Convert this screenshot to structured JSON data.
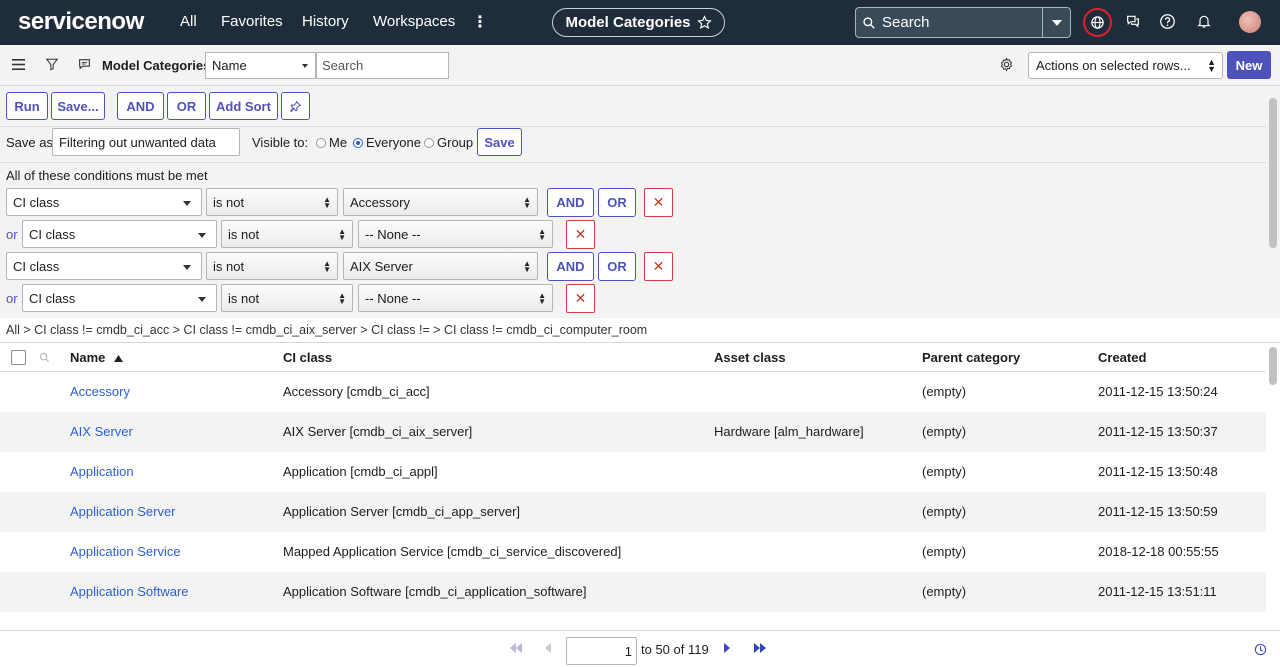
{
  "nav": {
    "logo": "servicenow",
    "links": [
      "All",
      "Favorites",
      "History",
      "Workspaces"
    ],
    "center_pill": "Model Categories",
    "search_placeholder": "Search"
  },
  "listbar": {
    "title": "Model Categories",
    "field_select": "Name",
    "search_placeholder": "Search",
    "actions_select": "Actions on selected rows...",
    "new_label": "New"
  },
  "filter": {
    "buttons": {
      "run": "Run",
      "save_dots": "Save...",
      "and": "AND",
      "or": "OR",
      "add_sort": "Add Sort"
    },
    "save_as_label": "Save as:",
    "save_as_value": "Filtering out unwanted data",
    "visible_to_label": "Visible to:",
    "visible_options": [
      "Me",
      "Everyone",
      "Group"
    ],
    "visible_selected": "Everyone",
    "save_label": "Save",
    "conditions_heading": "All of these conditions must be met",
    "or_label": "or",
    "conditions": [
      {
        "field": "CI class",
        "operator": "is not",
        "value": "Accessory",
        "prefix": ""
      },
      {
        "field": "CI class",
        "operator": "is not",
        "value": "-- None --",
        "prefix": "or"
      },
      {
        "field": "CI class",
        "operator": "is not",
        "value": "AIX Server",
        "prefix": ""
      },
      {
        "field": "CI class",
        "operator": "is not",
        "value": "-- None --",
        "prefix": "or"
      }
    ]
  },
  "breadcrumb": "All > CI class != cmdb_ci_acc > CI class != cmdb_ci_aix_server > CI class != > CI class != cmdb_ci_computer_room",
  "table": {
    "columns": [
      "Name",
      "CI class",
      "Asset class",
      "Parent category",
      "Created"
    ],
    "rows": [
      {
        "name": "Accessory",
        "ci_class": "Accessory [cmdb_ci_acc]",
        "asset_class": "",
        "parent": "(empty)",
        "created": "2011-12-15 13:50:24"
      },
      {
        "name": "AIX Server",
        "ci_class": "AIX Server [cmdb_ci_aix_server]",
        "asset_class": "Hardware [alm_hardware]",
        "parent": "(empty)",
        "created": "2011-12-15 13:50:37"
      },
      {
        "name": "Application",
        "ci_class": "Application [cmdb_ci_appl]",
        "asset_class": "",
        "parent": "(empty)",
        "created": "2011-12-15 13:50:48"
      },
      {
        "name": "Application Server",
        "ci_class": "Application Server [cmdb_ci_app_server]",
        "asset_class": "",
        "parent": "(empty)",
        "created": "2011-12-15 13:50:59"
      },
      {
        "name": "Application Service",
        "ci_class": "Mapped Application Service [cmdb_ci_service_discovered]",
        "asset_class": "",
        "parent": "(empty)",
        "created": "2018-12-18 00:55:55"
      },
      {
        "name": "Application Software",
        "ci_class": "Application Software [cmdb_ci_application_software]",
        "asset_class": "",
        "parent": "(empty)",
        "created": "2011-12-15 13:51:11"
      }
    ]
  },
  "pagination": {
    "current": "1",
    "range_text": "to 50 of 119"
  },
  "colors": {
    "nav_bg": "#1f2d3a",
    "accent": "#4f52bd",
    "link": "#2b5fd8",
    "danger": "#d04040"
  }
}
